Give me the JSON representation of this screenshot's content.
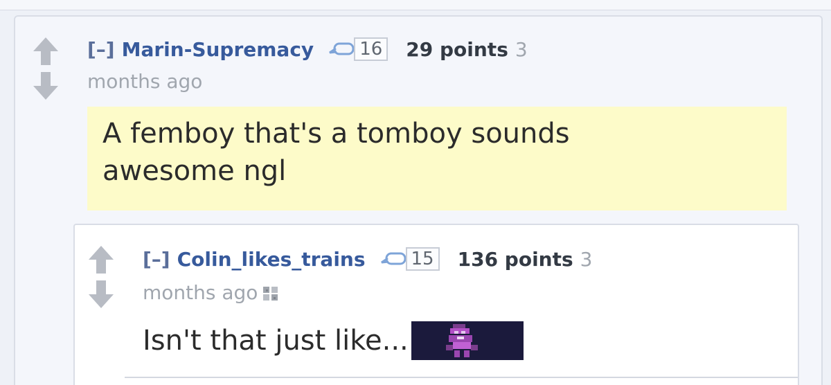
{
  "comments": [
    {
      "collapse": "[–]",
      "author": "Marin-Supremacy",
      "reply_count": "16",
      "points": "29 points",
      "time_prefix": "3",
      "time_suffix": "months ago",
      "body_line1": "A femboy that's a tomboy sounds",
      "body_line2": "awesome ngl"
    },
    {
      "collapse": "[–]",
      "author": "Colin_likes_trains",
      "reply_count": "15",
      "points": "136 points",
      "time_prefix": "3",
      "time_suffix": "months ago",
      "body_line1": "Isn't that just like..."
    }
  ],
  "icons": {
    "upvote": "arrow-up-icon",
    "downvote": "arrow-down-icon",
    "reply": "speech-bubble-icon",
    "gilded": "gilded-icon",
    "embedded": "embedded-image-thumbnail"
  },
  "colors": {
    "author": "#375a9c",
    "highlight": "#fdfbc9",
    "arrow": "#b8bcc4",
    "points": "#333a44"
  }
}
